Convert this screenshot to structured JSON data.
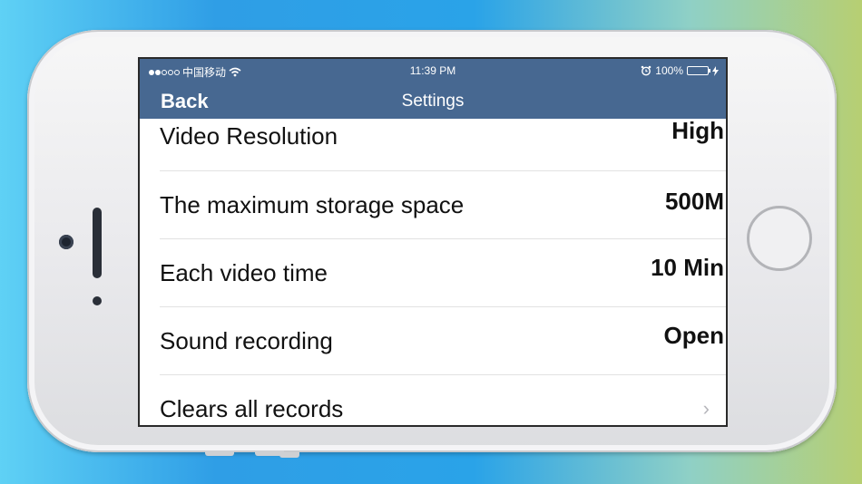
{
  "status_bar": {
    "carrier": "中国移动",
    "time": "11:39 PM",
    "battery": "100%",
    "signal_bars_filled": 2,
    "signal_bars_total": 5
  },
  "nav": {
    "back_label": "Back",
    "title": "Settings"
  },
  "settings": [
    {
      "label": "Video Resolution",
      "value": "High"
    },
    {
      "label": "The maximum storage space",
      "value": "500M"
    },
    {
      "label": "Each video time",
      "value": "10 Min"
    },
    {
      "label": "Sound recording",
      "value": "Open"
    },
    {
      "label": "Clears all records",
      "value": ""
    }
  ],
  "colors": {
    "navbar": "#476891",
    "battery_fill": "#4cd964"
  },
  "icons": [
    "wifi-icon",
    "alarm-icon",
    "battery-icon",
    "charging-icon",
    "chevron-right-icon"
  ]
}
